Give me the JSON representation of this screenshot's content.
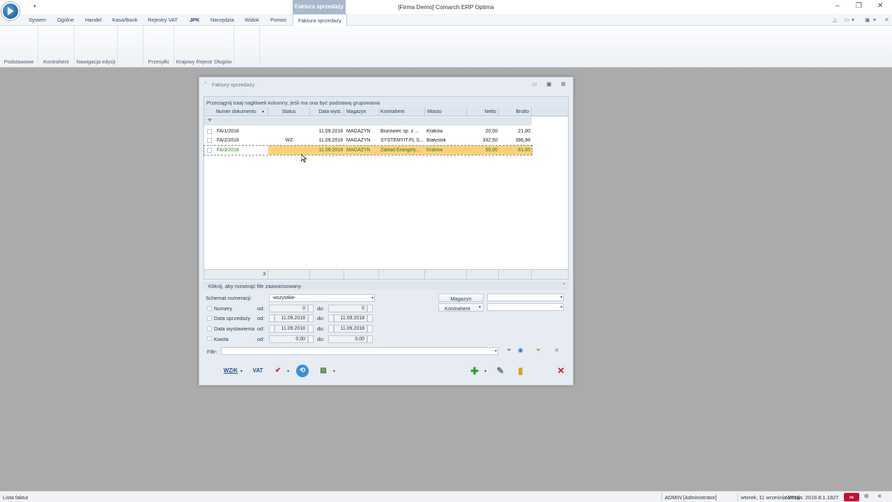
{
  "window": {
    "quick_access_arrow": "▾",
    "context_tab_title": "Faktura sprzedaży",
    "title": "[Firma Demo] Comarch ERP Optima",
    "controls": {
      "minimize": "–",
      "maximize": "❐",
      "close": "✕"
    }
  },
  "ribbon": {
    "tabs": [
      {
        "label": "System"
      },
      {
        "label": "Ogólne"
      },
      {
        "label": "Handel"
      },
      {
        "label": "Kasa/Bank"
      },
      {
        "label": "Rejestry VAT"
      },
      {
        "label": "JPK"
      },
      {
        "label": "Narzędzia"
      },
      {
        "label": "Widok"
      },
      {
        "label": "Pomoc"
      },
      {
        "label": "Faktura sprzedaży"
      }
    ],
    "right_icons": [
      "△",
      "▭",
      "▾",
      "▣",
      "▾",
      "✕"
    ],
    "groups": [
      {
        "label": "Podstawowe"
      },
      {
        "label": "Kontrahent"
      },
      {
        "label": "Nawigacja edycji"
      },
      {
        "label": ""
      },
      {
        "label": "Przesyłki"
      },
      {
        "label": "Krajowy Rejestr Długów"
      }
    ]
  },
  "dialog": {
    "pin_icon": "⁼",
    "title": "Faktury sprzedaży",
    "controls": {
      "minimize": "▭",
      "maximize": "▣",
      "close": "⊠"
    },
    "group_hint": "Przeciągnij tutaj nagłówek kolumny, jeśli ma ona być podstawą grupowania",
    "columns": [
      "Numer dokumentu",
      "Status",
      "Data wyst.",
      "Magazyn",
      "Kontrahent",
      "Miasto",
      "Netto",
      "Brutto"
    ],
    "sort_indicator": "▲",
    "rows": [
      {
        "numer": "FA/1/2018",
        "status": "",
        "data": "11.09.2018",
        "magazyn": "MAGAZYN",
        "kontrahent": "Biurowiec sp. z ...",
        "miasto": "Kraków",
        "netto": "20,00",
        "brutto": "21,60"
      },
      {
        "numer": "FA/2/2018",
        "status": "WZ",
        "data": "11.09.2018",
        "magazyn": "MAGAZYN",
        "kontrahent": "SYSTEMYIT.PL S...",
        "miasto": "Białystok",
        "netto": "332,50",
        "brutto": "396,98"
      },
      {
        "numer": "FA/3/2018",
        "status": "",
        "data": "11.09.2018",
        "magazyn": "MAGAZYN",
        "kontrahent": "Zakład Energety...",
        "miasto": "Kraków",
        "netto": "55,00",
        "brutto": "61,65"
      }
    ],
    "row_count": "3",
    "advanced_filter": "Kliknij, aby rozwinąć filtr zaawansowany",
    "advanced_filter_icon": "⌃",
    "schemat_label": "Schemat numeracji:",
    "schemat_value": "-wszystkie-",
    "numery_label": "Numery",
    "data_sprzedazy_label": "Data sprzedaży",
    "data_wystawienia_label": "Data wystawienia",
    "kwota_label": "Kwota",
    "od_label": "od:",
    "do_label": "do:",
    "numery_od": "0",
    "numery_do": "0",
    "ds_od": "11.09.2018",
    "ds_do": "11.09.2018",
    "dw_od": "11.09.2018",
    "dw_do": "11.09.2018",
    "kwota_od": "0,00",
    "kwota_do": "0,00",
    "magazyn_btn": "Magazyn",
    "kontrahent_btn": "Kontrahent",
    "filtr_label": "Filtr:",
    "toolbar": {
      "wzk": "WZ/K",
      "vat": "VAT",
      "approve": "✔",
      "refresh": "⟲",
      "print": "▤",
      "add": "✚",
      "edit": "✎",
      "delete": "▮",
      "close": "✕"
    }
  },
  "statusbar": {
    "left": "Lista faktur",
    "user": "ADMIN [Administrator]",
    "date": "wtorek, 11 września 2018",
    "version": "Wersja: 2018.8.1.1827"
  }
}
